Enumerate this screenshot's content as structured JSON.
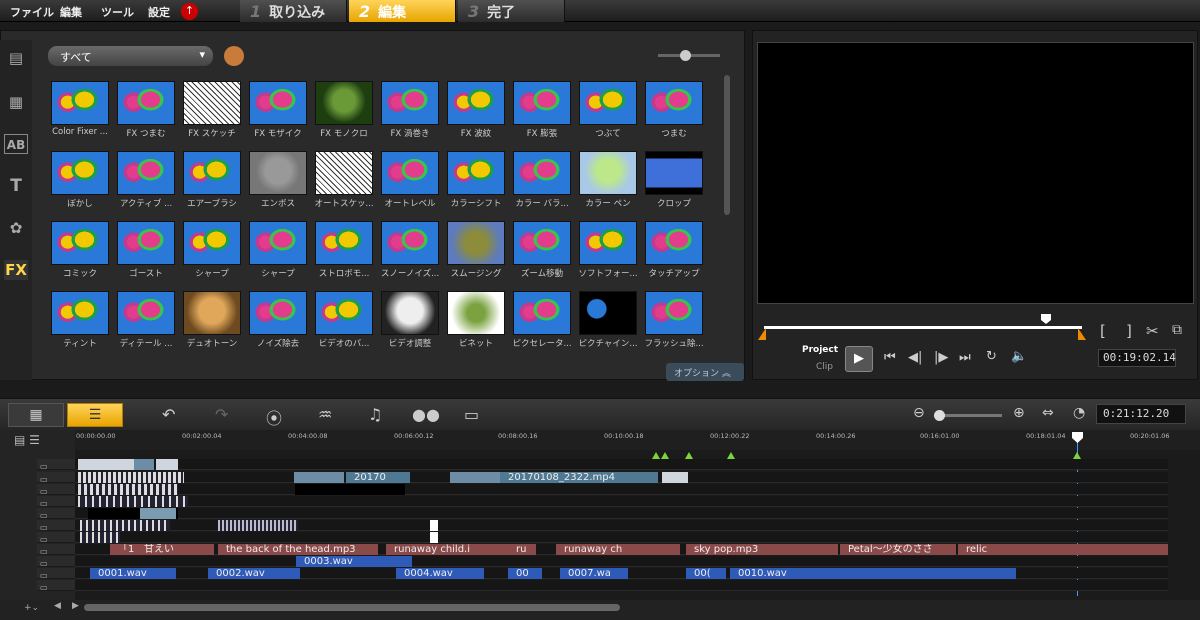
{
  "menu": {
    "file": "ファイル",
    "edit": "編集",
    "tools": "ツール",
    "settings": "設定"
  },
  "steps": [
    {
      "n": "1",
      "label": "取り込み"
    },
    {
      "n": "2",
      "label": "編集"
    },
    {
      "n": "3",
      "label": "完了"
    }
  ],
  "library": {
    "dropdown": "すべて",
    "options_label": "オプション"
  },
  "effects": [
    "Color Fixer ...",
    "FX つまむ",
    "FX スケッチ",
    "FX モザイク",
    "FX モノクロ",
    "FX 渦巻き",
    "FX 波紋",
    "FX 膨張",
    "つぶて",
    "つまむ",
    "ぼかし",
    "アクティブ ...",
    "エアーブラシ",
    "エンボス",
    "オートスケッ...",
    "オートレベル",
    "カラーシフト",
    "カラー バラ...",
    "カラー ペン",
    "クロップ",
    "コミック",
    "ゴースト",
    "シャープ",
    "シャープ",
    "ストロボモ...",
    "スノーノイズ...",
    "スムージング",
    "ズーム移動",
    "ソフトフォー...",
    "タッチアップ",
    "ティント",
    "ディテール ...",
    "デュオトーン",
    "ノイズ除去",
    "ビデオのバ...",
    "ビデオ調整",
    "ビネット",
    "ピクセレータ...",
    "ピクチャイン...",
    "フラッシュ除..."
  ],
  "preview": {
    "project": "Project",
    "clip": "Clip",
    "timecode": "00:19:02.14"
  },
  "timeline": {
    "timecode": "0:21:12.20",
    "ticks": [
      "00:00:00.00",
      "00:02:00.04",
      "00:04:00.08",
      "00:06:00.12",
      "00:08:00.16",
      "00:10:00.18",
      "00:12:00.22",
      "00:14:00.26",
      "00:16:01.00",
      "00:18:01.04",
      "00:20:01.06"
    ]
  },
  "clips": {
    "v1a": "20170",
    "v1b": "20170108_2322.mp4",
    "a1a": "「1",
    "a1b": "甘えい",
    "a1c": "the back of the head.mp3",
    "a1d": "runaway child.i",
    "a1e": "ru",
    "a1f": "runaway ch",
    "a1g": "sky pop.mp3",
    "a1h": "Petal～少女のささ",
    "a1i": "relic",
    "a2a": "0003.wav",
    "a3a": "0001.wav",
    "a3b": "0002.wav",
    "a3c": "0004.wav",
    "a3d": "00",
    "a3e": "0007.wa",
    "a3f": "00(",
    "a3g": "0010.wav"
  },
  "colors": {
    "accent": "#f0b400",
    "audio_clip": "#8b4a4a",
    "voice_clip": "#2e5bb8"
  }
}
